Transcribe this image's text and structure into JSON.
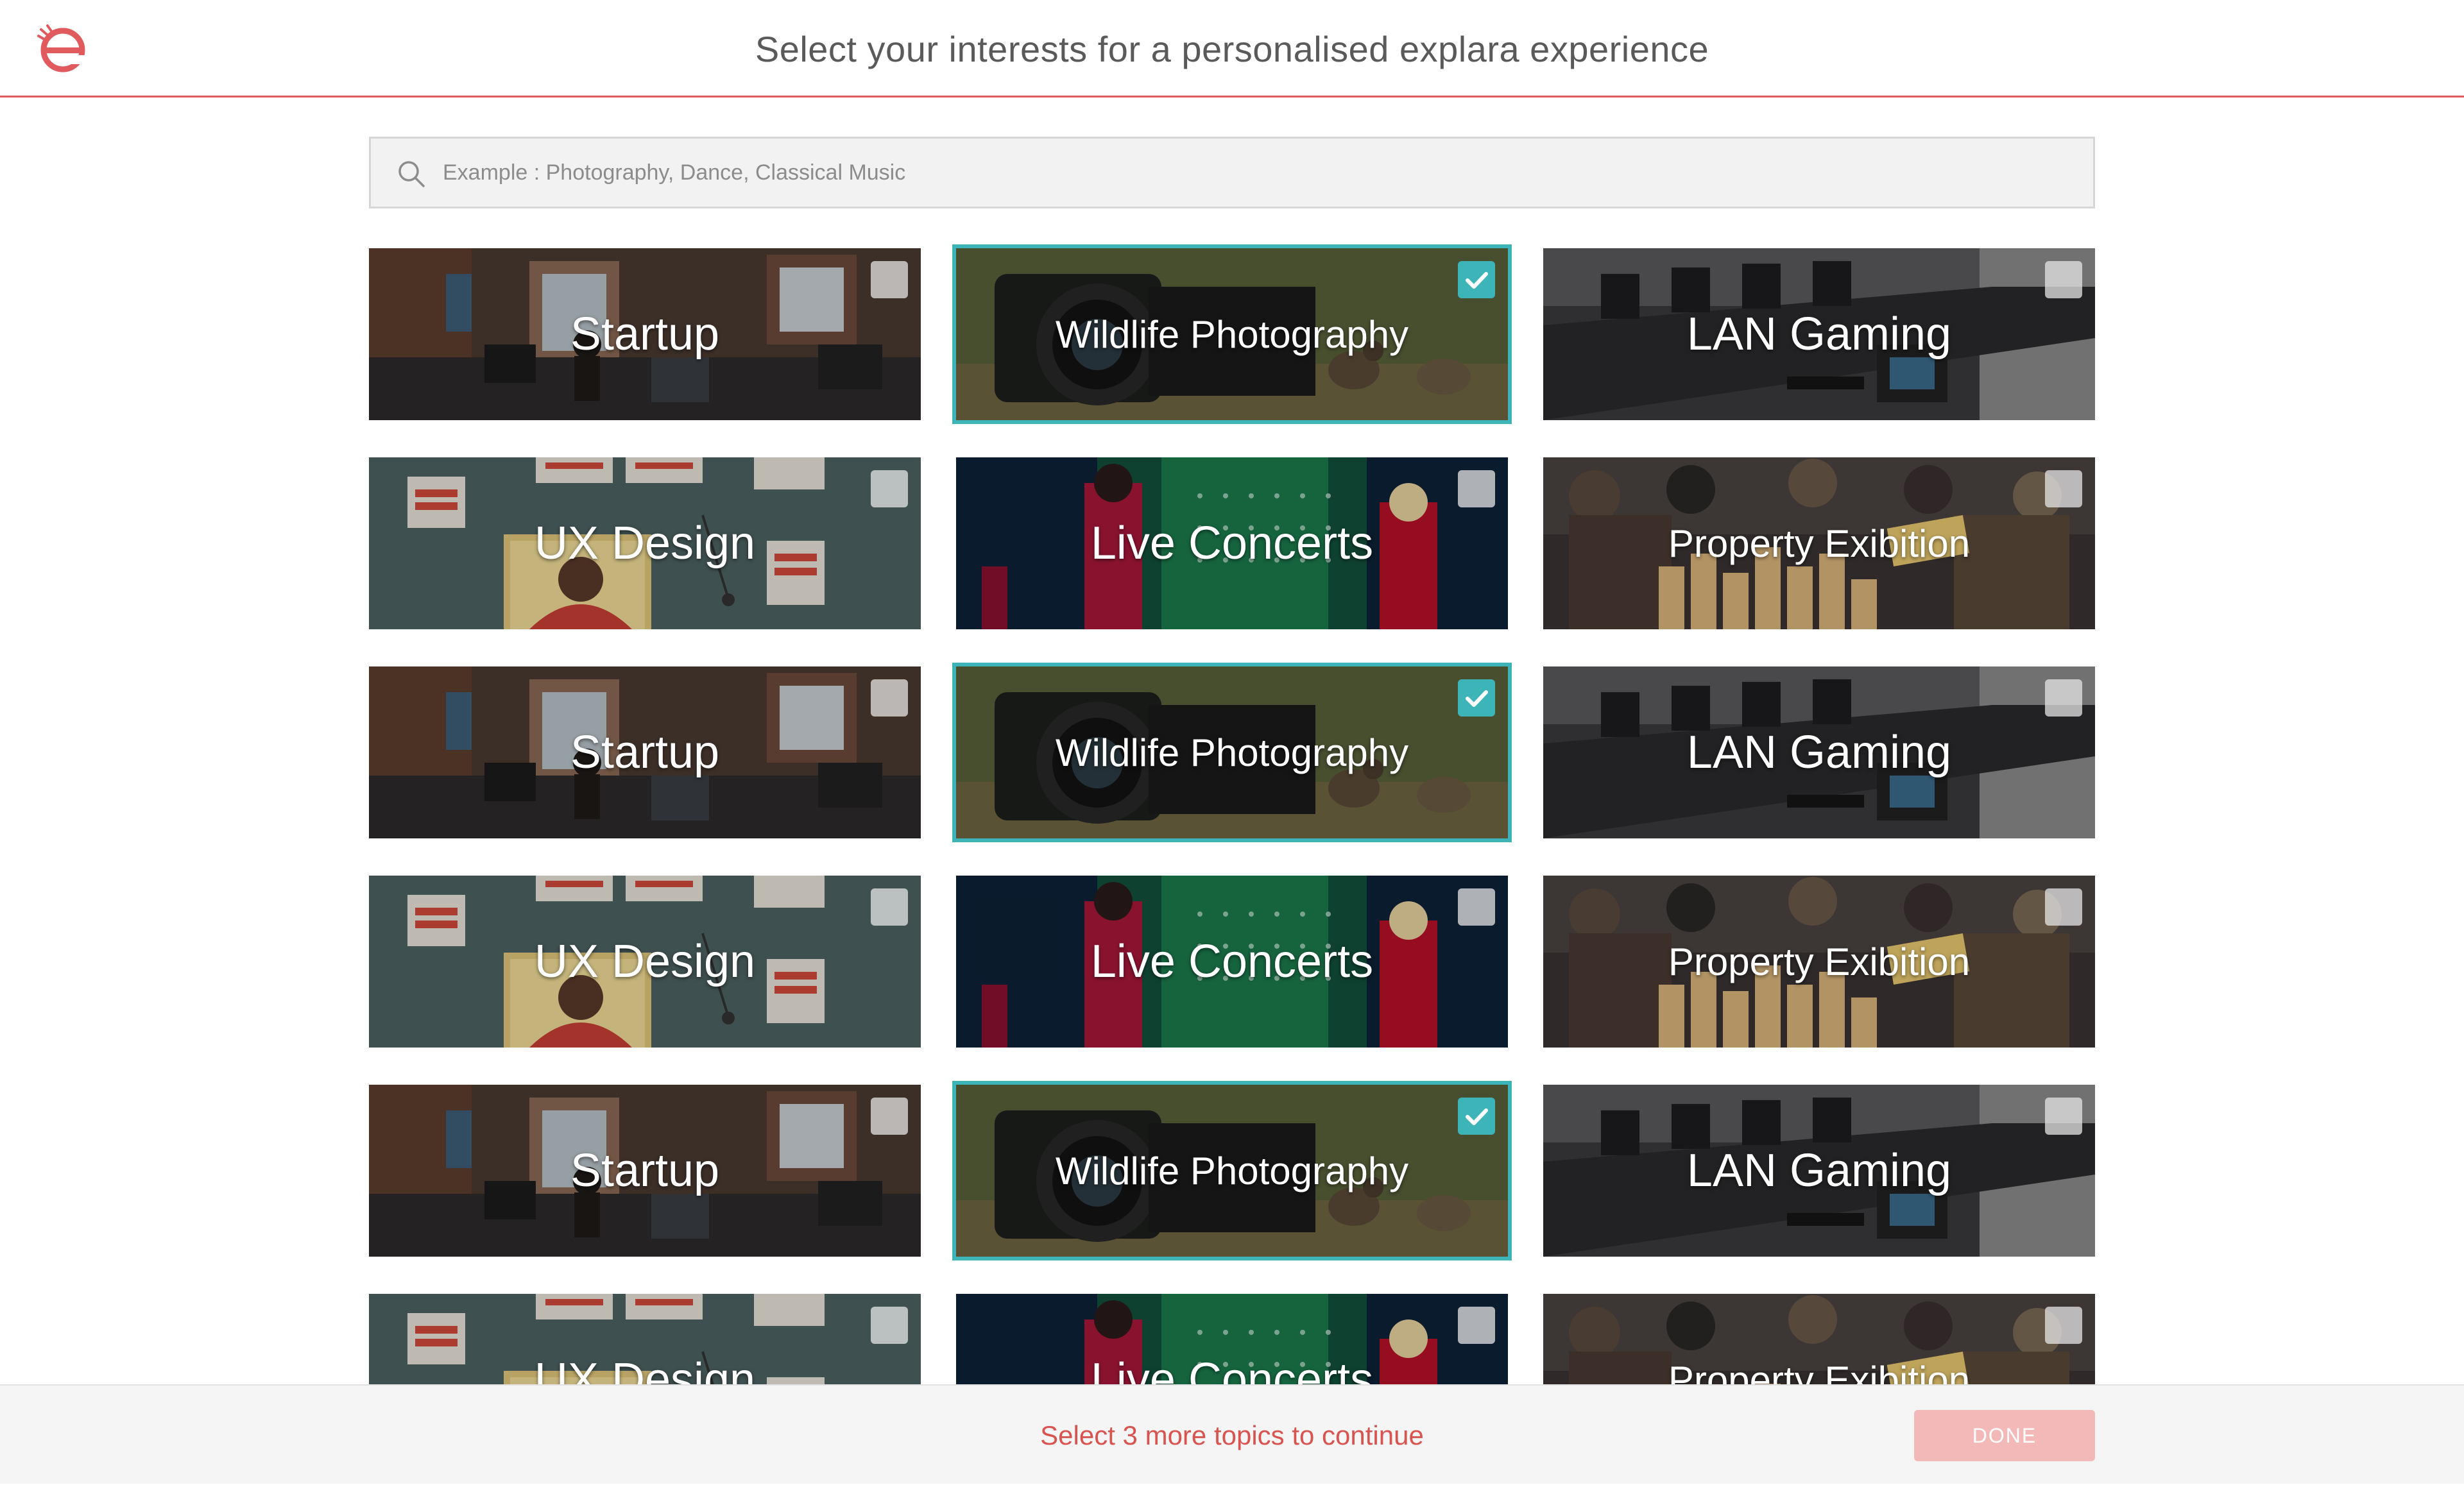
{
  "header": {
    "title": "Select your interests for a personalised explara experience",
    "brand_color": "#e05a5e"
  },
  "search": {
    "placeholder": "Example : Photography, Dance, Classical Music",
    "value": ""
  },
  "cards": [
    {
      "label": "Startup",
      "selected": false,
      "theme": "startup"
    },
    {
      "label": "Wildlife Photography",
      "selected": true,
      "theme": "wildlife"
    },
    {
      "label": "LAN Gaming",
      "selected": false,
      "theme": "gaming"
    },
    {
      "label": "UX Design",
      "selected": false,
      "theme": "ux"
    },
    {
      "label": "Live Concerts",
      "selected": false,
      "theme": "concert"
    },
    {
      "label": "Property Exibition",
      "selected": false,
      "theme": "property"
    },
    {
      "label": "Startup",
      "selected": false,
      "theme": "startup"
    },
    {
      "label": "Wildlife Photography",
      "selected": true,
      "theme": "wildlife"
    },
    {
      "label": "LAN Gaming",
      "selected": false,
      "theme": "gaming"
    },
    {
      "label": "UX Design",
      "selected": false,
      "theme": "ux"
    },
    {
      "label": "Live Concerts",
      "selected": false,
      "theme": "concert"
    },
    {
      "label": "Property Exibition",
      "selected": false,
      "theme": "property"
    },
    {
      "label": "Startup",
      "selected": false,
      "theme": "startup"
    },
    {
      "label": "Wildlife Photography",
      "selected": true,
      "theme": "wildlife"
    },
    {
      "label": "LAN Gaming",
      "selected": false,
      "theme": "gaming"
    },
    {
      "label": "UX Design",
      "selected": false,
      "theme": "ux"
    },
    {
      "label": "Live Concerts",
      "selected": false,
      "theme": "concert"
    },
    {
      "label": "Property Exibition",
      "selected": false,
      "theme": "property"
    }
  ],
  "footer": {
    "message": "Select 3 more topics to continue",
    "done_label": "DONE"
  },
  "colors": {
    "accent": "#3cb4b8",
    "warning": "#d9534f",
    "done_disabled": "#f3b8b8"
  },
  "icons": {
    "logo": "explara-logo",
    "search": "search-icon",
    "checkbox": "checkbox-icon",
    "check": "check-icon"
  }
}
